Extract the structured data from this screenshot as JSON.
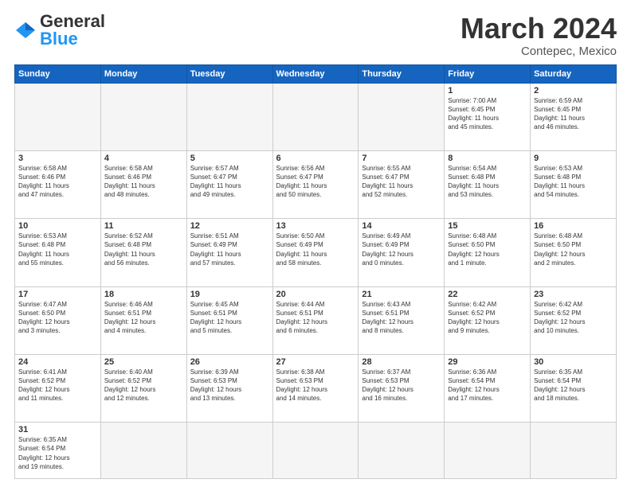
{
  "header": {
    "logo_general": "General",
    "logo_blue": "Blue",
    "month_title": "March 2024",
    "subtitle": "Contepec, Mexico"
  },
  "days_of_week": [
    "Sunday",
    "Monday",
    "Tuesday",
    "Wednesday",
    "Thursday",
    "Friday",
    "Saturday"
  ],
  "weeks": [
    [
      {
        "day": "",
        "info": ""
      },
      {
        "day": "",
        "info": ""
      },
      {
        "day": "",
        "info": ""
      },
      {
        "day": "",
        "info": ""
      },
      {
        "day": "",
        "info": ""
      },
      {
        "day": "1",
        "info": "Sunrise: 7:00 AM\nSunset: 6:45 PM\nDaylight: 11 hours\nand 45 minutes."
      },
      {
        "day": "2",
        "info": "Sunrise: 6:59 AM\nSunset: 6:45 PM\nDaylight: 11 hours\nand 46 minutes."
      }
    ],
    [
      {
        "day": "3",
        "info": "Sunrise: 6:58 AM\nSunset: 6:46 PM\nDaylight: 11 hours\nand 47 minutes."
      },
      {
        "day": "4",
        "info": "Sunrise: 6:58 AM\nSunset: 6:46 PM\nDaylight: 11 hours\nand 48 minutes."
      },
      {
        "day": "5",
        "info": "Sunrise: 6:57 AM\nSunset: 6:47 PM\nDaylight: 11 hours\nand 49 minutes."
      },
      {
        "day": "6",
        "info": "Sunrise: 6:56 AM\nSunset: 6:47 PM\nDaylight: 11 hours\nand 50 minutes."
      },
      {
        "day": "7",
        "info": "Sunrise: 6:55 AM\nSunset: 6:47 PM\nDaylight: 11 hours\nand 52 minutes."
      },
      {
        "day": "8",
        "info": "Sunrise: 6:54 AM\nSunset: 6:48 PM\nDaylight: 11 hours\nand 53 minutes."
      },
      {
        "day": "9",
        "info": "Sunrise: 6:53 AM\nSunset: 6:48 PM\nDaylight: 11 hours\nand 54 minutes."
      }
    ],
    [
      {
        "day": "10",
        "info": "Sunrise: 6:53 AM\nSunset: 6:48 PM\nDaylight: 11 hours\nand 55 minutes."
      },
      {
        "day": "11",
        "info": "Sunrise: 6:52 AM\nSunset: 6:48 PM\nDaylight: 11 hours\nand 56 minutes."
      },
      {
        "day": "12",
        "info": "Sunrise: 6:51 AM\nSunset: 6:49 PM\nDaylight: 11 hours\nand 57 minutes."
      },
      {
        "day": "13",
        "info": "Sunrise: 6:50 AM\nSunset: 6:49 PM\nDaylight: 11 hours\nand 58 minutes."
      },
      {
        "day": "14",
        "info": "Sunrise: 6:49 AM\nSunset: 6:49 PM\nDaylight: 12 hours\nand 0 minutes."
      },
      {
        "day": "15",
        "info": "Sunrise: 6:48 AM\nSunset: 6:50 PM\nDaylight: 12 hours\nand 1 minute."
      },
      {
        "day": "16",
        "info": "Sunrise: 6:48 AM\nSunset: 6:50 PM\nDaylight: 12 hours\nand 2 minutes."
      }
    ],
    [
      {
        "day": "17",
        "info": "Sunrise: 6:47 AM\nSunset: 6:50 PM\nDaylight: 12 hours\nand 3 minutes."
      },
      {
        "day": "18",
        "info": "Sunrise: 6:46 AM\nSunset: 6:51 PM\nDaylight: 12 hours\nand 4 minutes."
      },
      {
        "day": "19",
        "info": "Sunrise: 6:45 AM\nSunset: 6:51 PM\nDaylight: 12 hours\nand 5 minutes."
      },
      {
        "day": "20",
        "info": "Sunrise: 6:44 AM\nSunset: 6:51 PM\nDaylight: 12 hours\nand 6 minutes."
      },
      {
        "day": "21",
        "info": "Sunrise: 6:43 AM\nSunset: 6:51 PM\nDaylight: 12 hours\nand 8 minutes."
      },
      {
        "day": "22",
        "info": "Sunrise: 6:42 AM\nSunset: 6:52 PM\nDaylight: 12 hours\nand 9 minutes."
      },
      {
        "day": "23",
        "info": "Sunrise: 6:42 AM\nSunset: 6:52 PM\nDaylight: 12 hours\nand 10 minutes."
      }
    ],
    [
      {
        "day": "24",
        "info": "Sunrise: 6:41 AM\nSunset: 6:52 PM\nDaylight: 12 hours\nand 11 minutes."
      },
      {
        "day": "25",
        "info": "Sunrise: 6:40 AM\nSunset: 6:52 PM\nDaylight: 12 hours\nand 12 minutes."
      },
      {
        "day": "26",
        "info": "Sunrise: 6:39 AM\nSunset: 6:53 PM\nDaylight: 12 hours\nand 13 minutes."
      },
      {
        "day": "27",
        "info": "Sunrise: 6:38 AM\nSunset: 6:53 PM\nDaylight: 12 hours\nand 14 minutes."
      },
      {
        "day": "28",
        "info": "Sunrise: 6:37 AM\nSunset: 6:53 PM\nDaylight: 12 hours\nand 16 minutes."
      },
      {
        "day": "29",
        "info": "Sunrise: 6:36 AM\nSunset: 6:54 PM\nDaylight: 12 hours\nand 17 minutes."
      },
      {
        "day": "30",
        "info": "Sunrise: 6:35 AM\nSunset: 6:54 PM\nDaylight: 12 hours\nand 18 minutes."
      }
    ],
    [
      {
        "day": "31",
        "info": "Sunrise: 6:35 AM\nSunset: 6:54 PM\nDaylight: 12 hours\nand 19 minutes."
      },
      {
        "day": "",
        "info": ""
      },
      {
        "day": "",
        "info": ""
      },
      {
        "day": "",
        "info": ""
      },
      {
        "day": "",
        "info": ""
      },
      {
        "day": "",
        "info": ""
      },
      {
        "day": "",
        "info": ""
      }
    ]
  ]
}
